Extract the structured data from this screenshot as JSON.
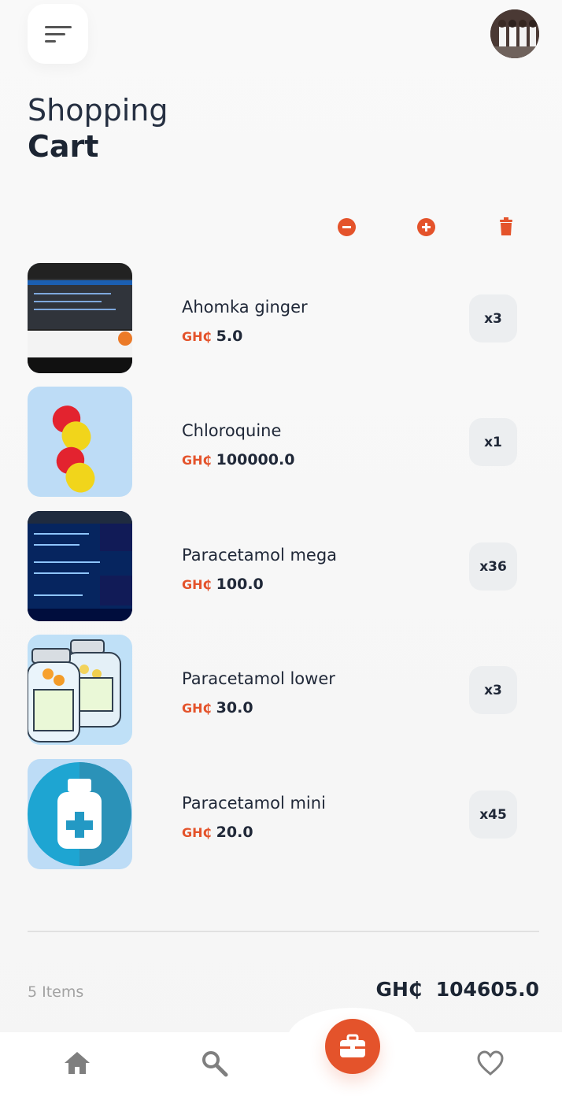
{
  "header": {
    "title_line1": "Shopping",
    "title_line2": "Cart",
    "menu_icon": "menu-icon",
    "avatar": "profile-avatar"
  },
  "actions": [
    {
      "icon": "minus-circle-icon"
    },
    {
      "icon": "plus-circle-icon"
    },
    {
      "icon": "trash-icon"
    }
  ],
  "items": [
    {
      "name": "Ahomka ginger",
      "currency": "GH₵",
      "price": "5.0",
      "quantity": "x3"
    },
    {
      "name": "Chloroquine",
      "currency": "GH₵",
      "price": "100000.0",
      "quantity": "x1"
    },
    {
      "name": "Paracetamol mega",
      "currency": "GH₵",
      "price": "100.0",
      "quantity": "x36"
    },
    {
      "name": "Paracetamol lower",
      "currency": "GH₵",
      "price": "30.0",
      "quantity": "x3"
    },
    {
      "name": "Paracetamol mini",
      "currency": "GH₵",
      "price": "20.0",
      "quantity": "x45"
    }
  ],
  "summary": {
    "item_count": "5 Items",
    "total_currency": "GH₵",
    "total": "104605.0"
  },
  "bottom_nav": [
    {
      "icon": "home-icon"
    },
    {
      "icon": "search-icon"
    },
    {
      "icon": "briefcase-icon"
    },
    {
      "icon": "heart-icon"
    }
  ],
  "colors": {
    "accent": "#E4532B",
    "text": "#1C2533",
    "background": "#F7F7F7"
  }
}
